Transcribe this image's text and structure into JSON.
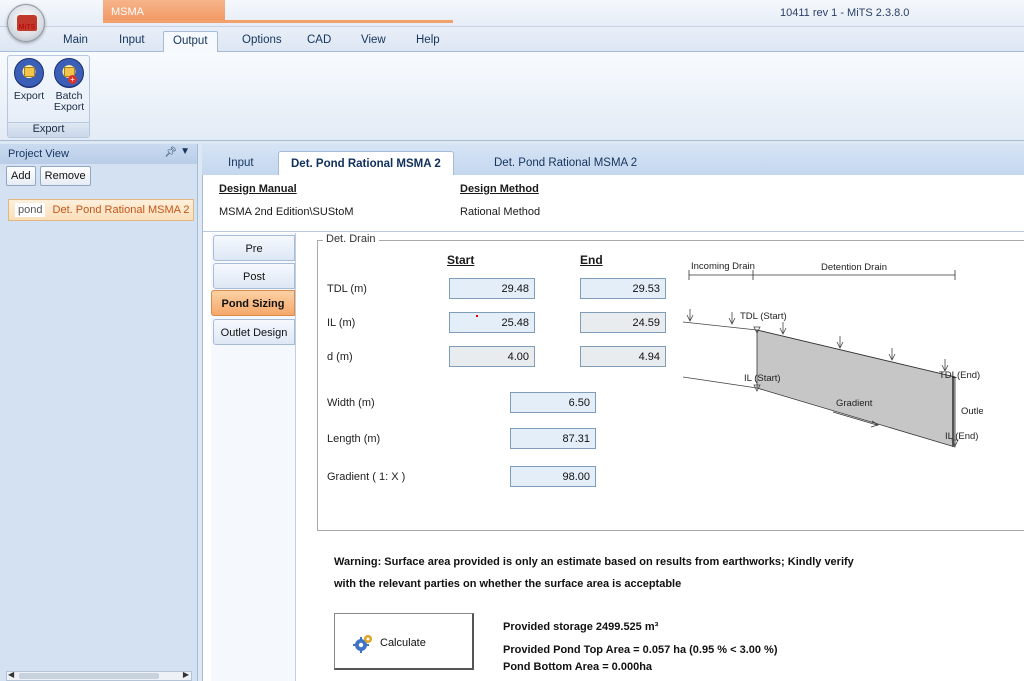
{
  "app": {
    "logo_text": "MiTS",
    "context_tab": "MSMA",
    "window_title": "10411 rev 1 - MiTS 2.3.8.0"
  },
  "menu": {
    "tabs": [
      "Main",
      "Input",
      "Output",
      "Options",
      "CAD",
      "View",
      "Help"
    ],
    "active": "Output"
  },
  "ribbon": {
    "group_label": "Export",
    "buttons": [
      {
        "label": "Export",
        "icon": "export-icon"
      },
      {
        "label": "Batch Export",
        "icon": "batch-export-icon"
      }
    ]
  },
  "project_view": {
    "title": "Project View",
    "add_label": "Add",
    "remove_label": "Remove",
    "item_tag": "pond",
    "item_name": "Det. Pond Rational MSMA 2"
  },
  "doc_tabs": [
    "Input",
    "Det. Pond Rational MSMA 2",
    "Det. Pond Rational MSMA 2"
  ],
  "header": {
    "design_manual_label": "Design Manual",
    "design_manual_value": "MSMA 2nd Edition\\SUStoM",
    "design_method_label": "Design Method",
    "design_method_value": "Rational Method"
  },
  "side_tabs": [
    "Pre",
    "Post",
    "Pond Sizing",
    "Outlet Design"
  ],
  "det_drain": {
    "legend": "Det. Drain",
    "start_label": "Start",
    "end_label": "End",
    "tdl_label": "TDL (m)",
    "tdl_start": "29.48",
    "tdl_end": "29.53",
    "il_label": "IL (m)",
    "il_start": "25.48",
    "il_end": "24.59",
    "d_label": "d (m)",
    "d_start": "4.00",
    "d_end": "4.94",
    "width_label": "Width (m)",
    "width_value": "6.50",
    "length_label": "Length (m)",
    "length_value": "87.31",
    "gradient_label": "Gradient ( 1: X )",
    "gradient_value": "98.00"
  },
  "diagram": {
    "incoming_drain": "Incoming Drain",
    "detention_drain": "Detention Drain",
    "tdl_start": "TDL (Start)",
    "tdl_end": "TDL(End)",
    "il_start": "IL (Start)",
    "il_end": "IL (End)",
    "gradient": "Gradient",
    "outlet": "Outlet"
  },
  "warning": {
    "line1": "Warning: Surface area provided is only an estimate based on results from earthworks; Kindly verify",
    "line2": "with the relevant parties on whether the surface area is acceptable"
  },
  "calculate_label": "Calculate",
  "results": {
    "storage": "Provided storage 2499.525 m³",
    "top_area": "Provided Pond Top Area = 0.057 ha (0.95 % < 3.00 %)",
    "bottom_area": "Pond Bottom Area = 0.000ha"
  }
}
